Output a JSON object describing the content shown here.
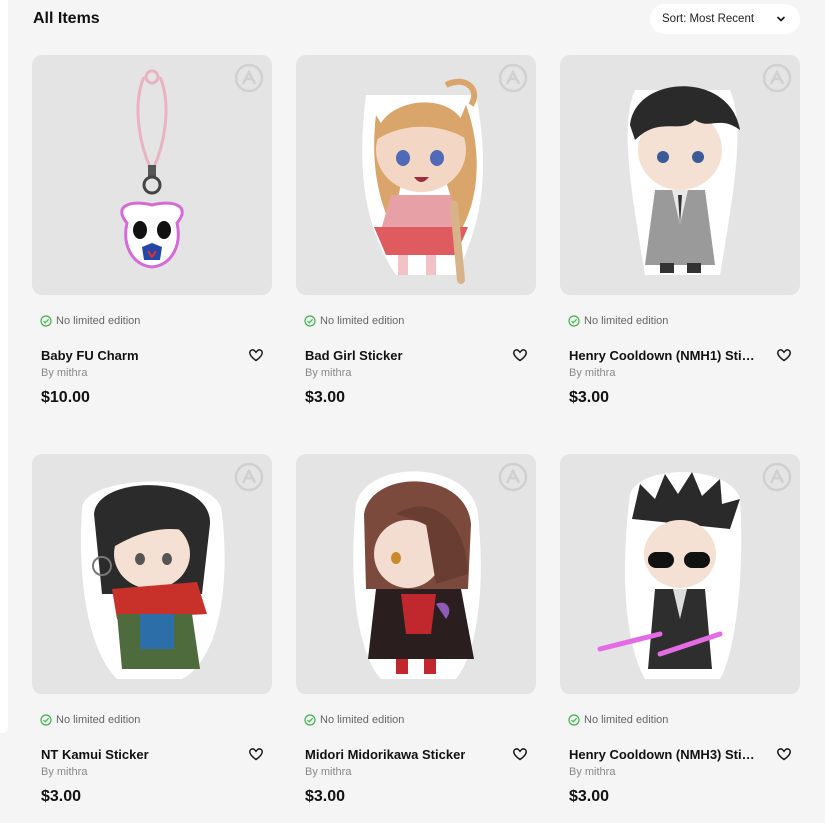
{
  "header": {
    "title": "All Items",
    "sort_label": "Sort: Most Recent"
  },
  "colors": {
    "check": "#3bb54a",
    "thumb_bg": "#e4e4e4"
  },
  "items": [
    {
      "title": "Baby FU Charm",
      "edition": "No limited edition",
      "by": "By mithra",
      "price": "$10.00",
      "art": "charm"
    },
    {
      "title": "Bad Girl Sticker",
      "edition": "No limited edition",
      "by": "By mithra",
      "price": "$3.00",
      "art": "bad-girl"
    },
    {
      "title": "Henry Cooldown (NMH1) Sticker",
      "edition": "No limited edition",
      "by": "By mithra",
      "price": "$3.00",
      "art": "henry1"
    },
    {
      "title": "NT Kamui Sticker",
      "edition": "No limited edition",
      "by": "By mithra",
      "price": "$3.00",
      "art": "kamui"
    },
    {
      "title": "Midori Midorikawa Sticker",
      "edition": "No limited edition",
      "by": "By mithra",
      "price": "$3.00",
      "art": "midori"
    },
    {
      "title": "Henry Cooldown (NMH3) Sticker",
      "edition": "No limited edition",
      "by": "By mithra",
      "price": "$3.00",
      "art": "henry3"
    }
  ]
}
